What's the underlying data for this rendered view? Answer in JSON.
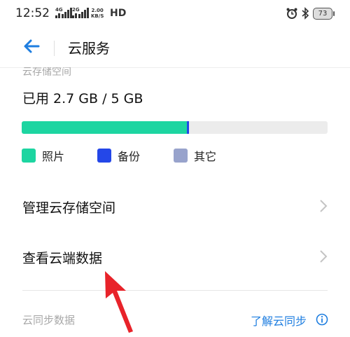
{
  "status_bar": {
    "time": "12:52",
    "sim1_tag": "4G",
    "sim2_tag": "2G",
    "speed_value": "2.00",
    "speed_unit": "KB/S",
    "hd": "HD",
    "battery": "73"
  },
  "header": {
    "title": "云服务"
  },
  "storage": {
    "section_label": "云存储空间",
    "usage_text": "已用 2.7 GB / 5 GB",
    "usage_fraction": {
      "photos": 0.54,
      "backup": 0.008
    },
    "legend": [
      {
        "label": "照片",
        "color": "#1dd5a1"
      },
      {
        "label": "备份",
        "color": "#2447e8"
      },
      {
        "label": "其它",
        "color": "#98a3cc"
      }
    ]
  },
  "menu": {
    "manage_storage": "管理云存储空间",
    "view_cloud_data": "查看云端数据"
  },
  "sync": {
    "section_label": "云同步数据",
    "learn_link": "了解云同步"
  },
  "colors": {
    "accent": "#1e7ee0",
    "annotation_arrow": "#e8232a"
  }
}
